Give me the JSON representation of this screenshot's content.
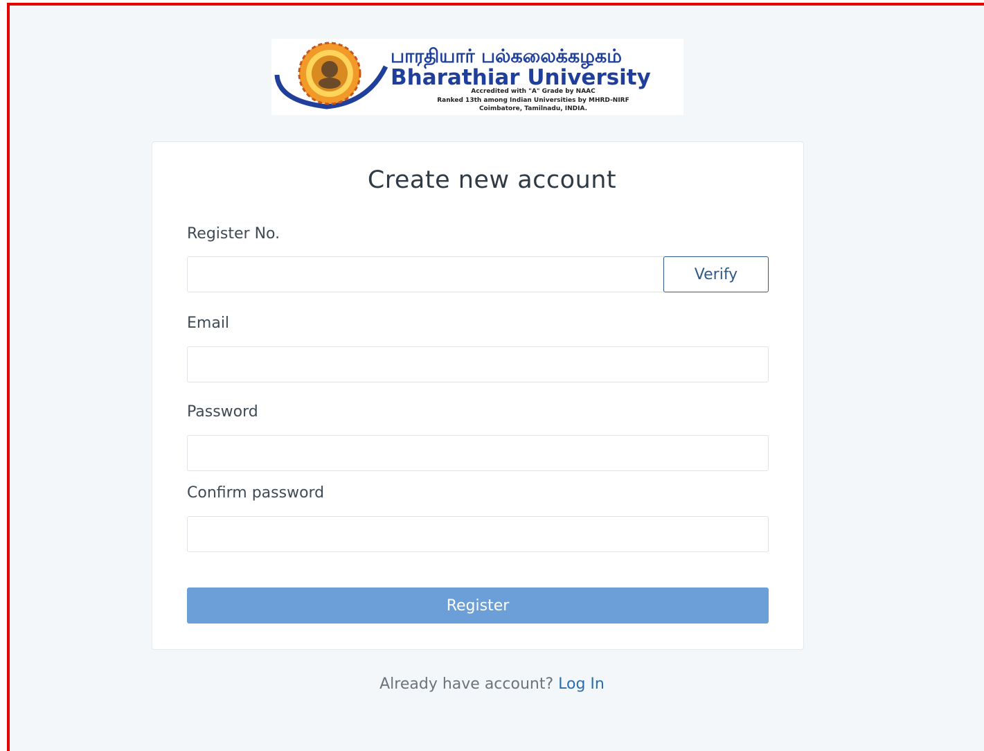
{
  "logo": {
    "tamil_name": "பாரதியார் பல்கலைக்கழகம்",
    "english_name": "Bharathiar University",
    "line1": "Accredited with \"A\" Grade by NAAC",
    "line2": "Ranked 13th among Indian Universities by MHRD-NIRF",
    "line3": "Coimbatore, Tamilnadu, INDIA."
  },
  "form": {
    "title": "Create new account",
    "register_no_label": "Register No.",
    "register_no_value": "",
    "verify_label": "Verify",
    "email_label": "Email",
    "email_value": "",
    "password_label": "Password",
    "password_value": "",
    "confirm_label": "Confirm password",
    "confirm_value": "",
    "register_label": "Register"
  },
  "footer": {
    "prompt": "Already have account?",
    "login_link": "Log In"
  },
  "colors": {
    "frame_border": "#e60000",
    "background": "#f4f7fa",
    "primary_button": "#6c9fd8",
    "link": "#2b6cb0",
    "logo_text_blue": "#1f3f9a"
  }
}
